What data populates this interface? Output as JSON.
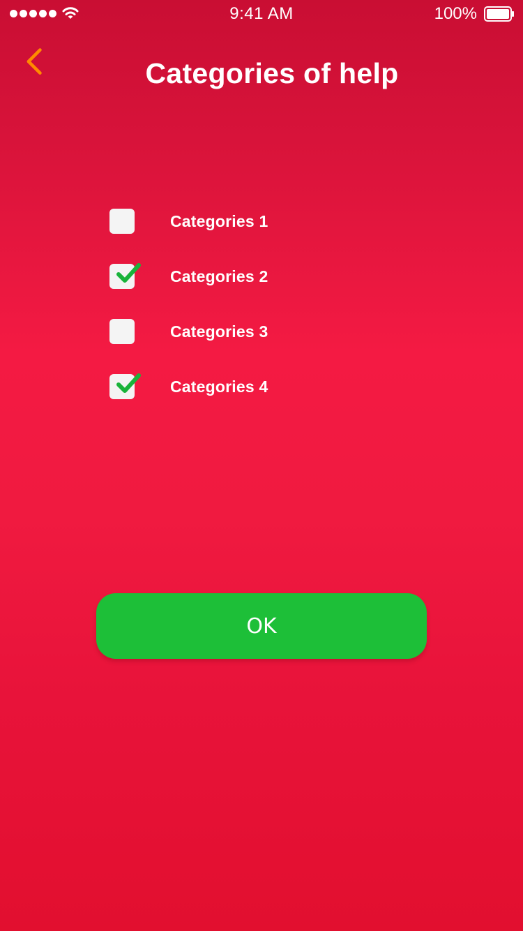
{
  "status_bar": {
    "time": "9:41 AM",
    "battery_percent": "100%",
    "signal_icon": "signal-dots-icon",
    "wifi_icon": "wifi-icon",
    "battery_icon": "battery-full-icon"
  },
  "header": {
    "back_icon": "chevron-left-icon",
    "title": "Categories of help"
  },
  "categories": [
    {
      "label": "Categories 1",
      "checked": false
    },
    {
      "label": "Categories 2",
      "checked": true
    },
    {
      "label": "Categories 3",
      "checked": false
    },
    {
      "label": "Categories 4",
      "checked": true
    }
  ],
  "ok_button": {
    "label": "OK"
  },
  "colors": {
    "background_top": "#c90e33",
    "background_mid": "#f41a43",
    "back_icon": "#ff8a00",
    "ok_button": "#1dbf38",
    "checkmark": "#19b33a",
    "checkbox": "#f4f4f4"
  }
}
